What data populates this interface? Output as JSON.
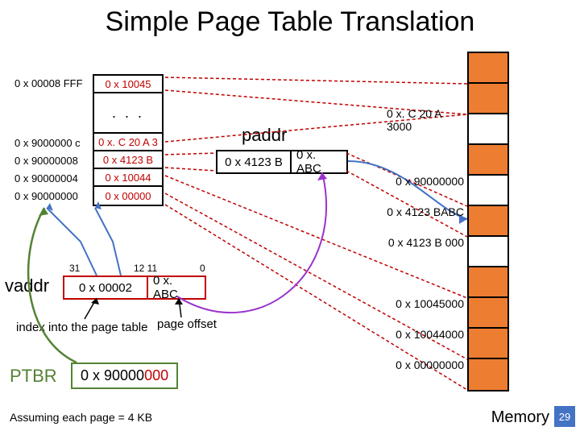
{
  "title": "Simple Page Table Translation",
  "page_table": {
    "top_addr": "0 x 00008 FFF",
    "top_entry": "0 x 10045",
    "ellipsis": ". . .",
    "addrs": [
      "0 x 9000000 c",
      "0 x 90000008",
      "0 x 90000004",
      "0 x 90000000"
    ],
    "entries": [
      "0 x. C 20 A 3",
      "0 x 4123 B",
      "0 x 10044",
      "0 x 00000"
    ]
  },
  "paddr": {
    "label": "paddr",
    "page": "0 x 4123 B",
    "offset": "0 x. ABC"
  },
  "vaddr": {
    "label": "vaddr",
    "bit_hi": "31",
    "bit_mid": "12 11",
    "bit_lo": "0",
    "index": "0 x 00002",
    "offset": "0 x. ABC"
  },
  "labels": {
    "index": "index into the page table",
    "offset": "page offset"
  },
  "ptbr": {
    "label": "PTBR",
    "value_prefix": "0 x 90000",
    "value_suffix": "000"
  },
  "memory": {
    "caption": "Memory",
    "labels": [
      {
        "text": "0 x. C 20 A 3000",
        "at": 2
      },
      {
        "text": "0 x 90000000",
        "at": 4
      },
      {
        "text": "0 x 4123 BABC",
        "at": 5
      },
      {
        "text": "0 x 4123 B 000",
        "at": 6
      },
      {
        "text": "0 x 10045000",
        "at": 8
      },
      {
        "text": "0 x 10044000",
        "at": 9
      },
      {
        "text": "0 x 00000000",
        "at": 10
      }
    ]
  },
  "assume": "Assuming each page = 4 KB",
  "slide_number": "29"
}
